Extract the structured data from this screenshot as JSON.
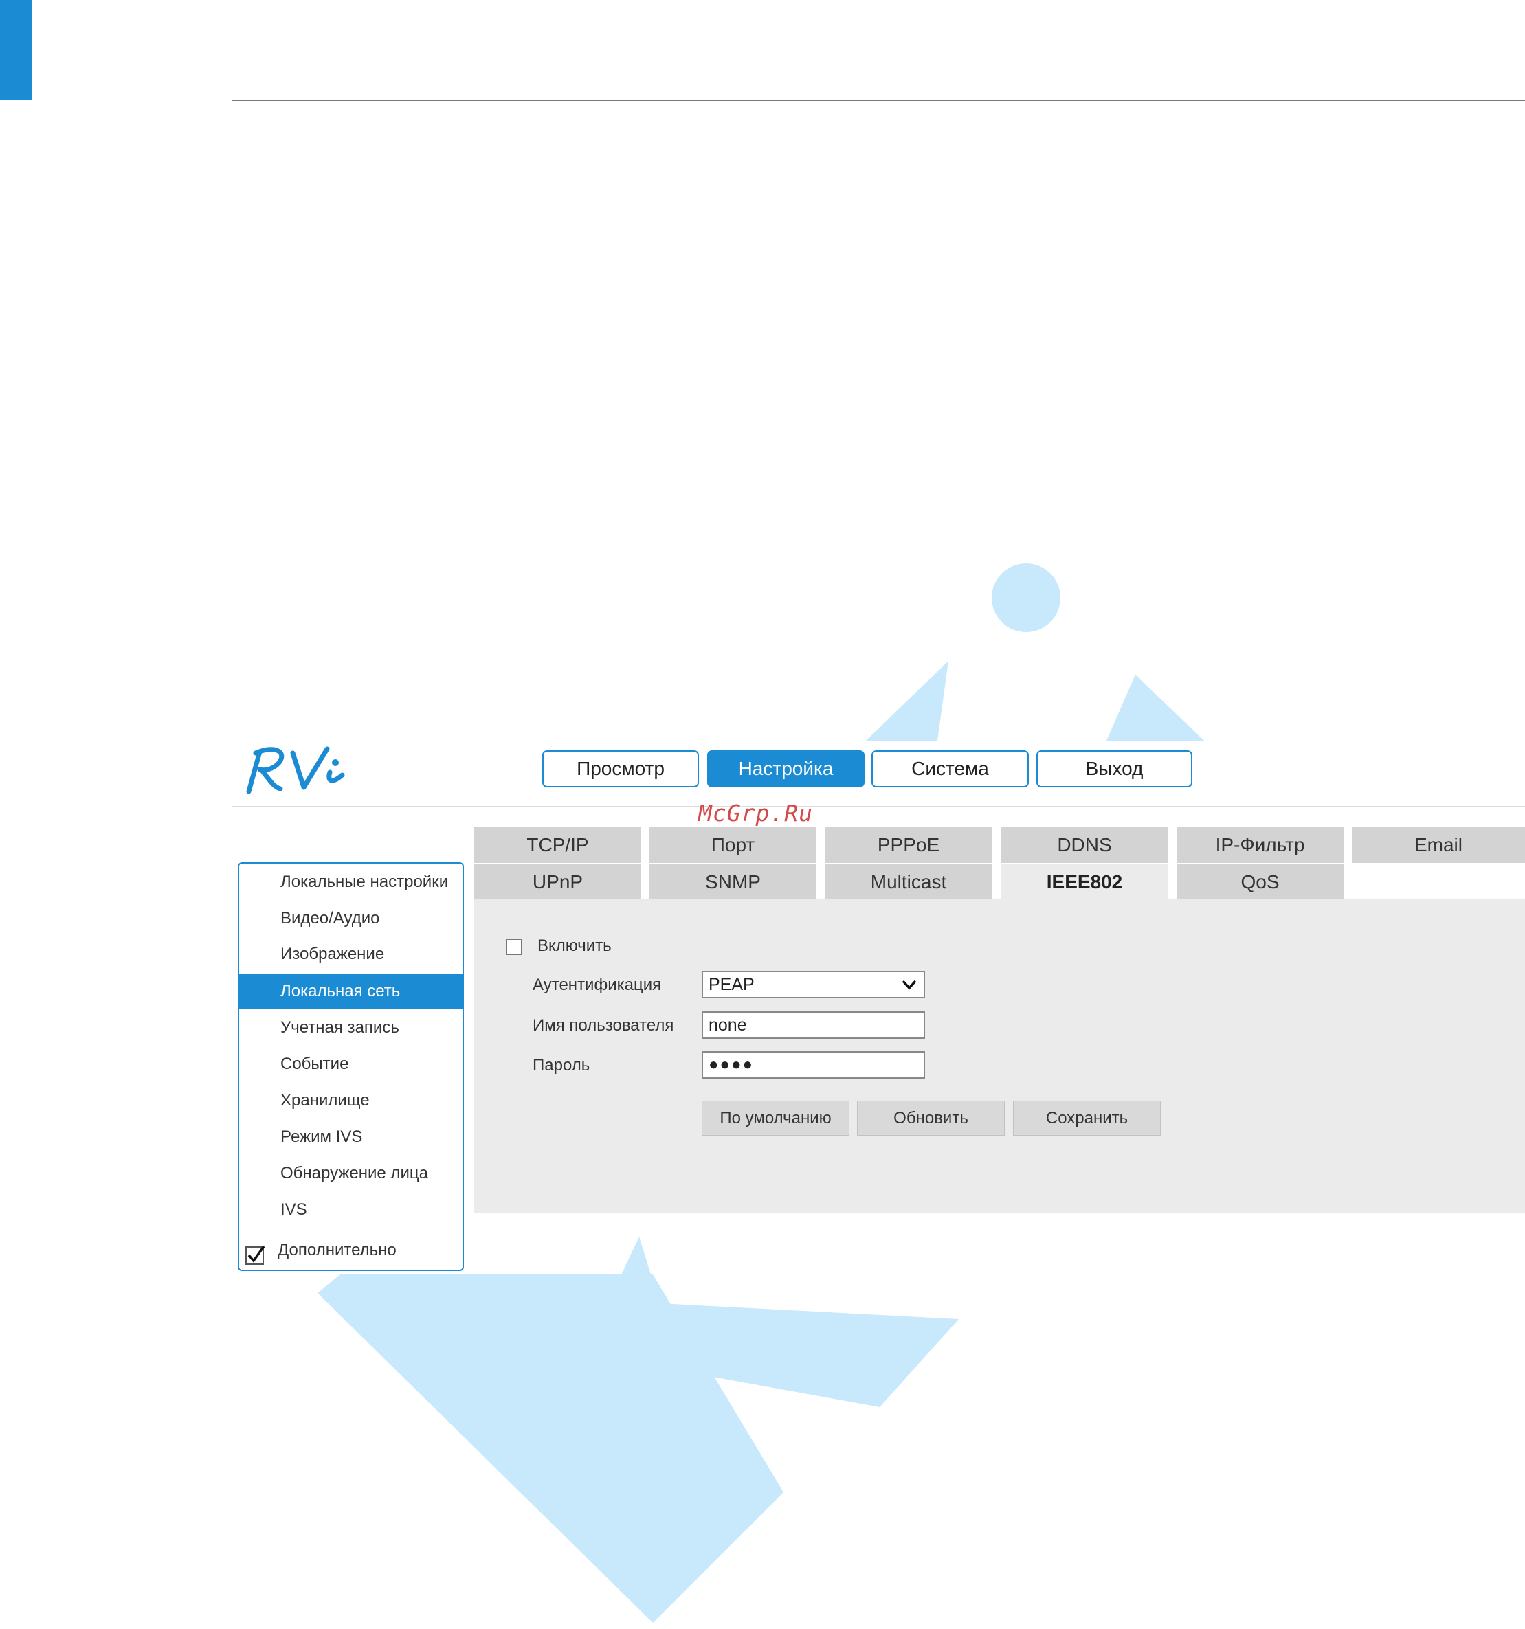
{
  "brand": {
    "logo_text": "RVi",
    "watermark_text": "McGrp.Ru"
  },
  "nav": {
    "buttons": [
      {
        "label": "Просмотр",
        "active": false
      },
      {
        "label": "Настройка",
        "active": true
      },
      {
        "label": "Система",
        "active": false
      },
      {
        "label": "Выход",
        "active": false
      }
    ]
  },
  "tabs": {
    "row1": [
      "TCP/IP",
      "Порт",
      "PPPoE",
      "DDNS",
      "IP-Фильтр",
      "Email"
    ],
    "row2": [
      "UPnP",
      "SNMP",
      "Multicast",
      "IEEE802",
      "QoS"
    ],
    "active": "IEEE802"
  },
  "form": {
    "enable_label": "Включить",
    "enable_checked": false,
    "auth_label": "Аутентификация",
    "auth_value": "PEAP",
    "username_label": "Имя пользователя",
    "username_value": "none",
    "password_label": "Пароль",
    "password_mask": "●●●●"
  },
  "actions": {
    "default_label": "По умолчанию",
    "refresh_label": "Обновить",
    "save_label": "Сохранить"
  },
  "sidebar": {
    "items": [
      "Локальные настройки",
      "Видео/Аудио",
      "Изображение",
      "Локальная сеть",
      "Учетная запись",
      "Событие",
      "Хранилище",
      "Режим IVS",
      "Обнаружение лица",
      "IVS"
    ],
    "active_index": 3,
    "advanced_label": "Дополнительно",
    "advanced_checked": true
  },
  "colors": {
    "accent": "#1b8bd3",
    "watermark": "#c8e8fb",
    "tab": "#d3d3d3",
    "panel": "#ebebeb"
  }
}
